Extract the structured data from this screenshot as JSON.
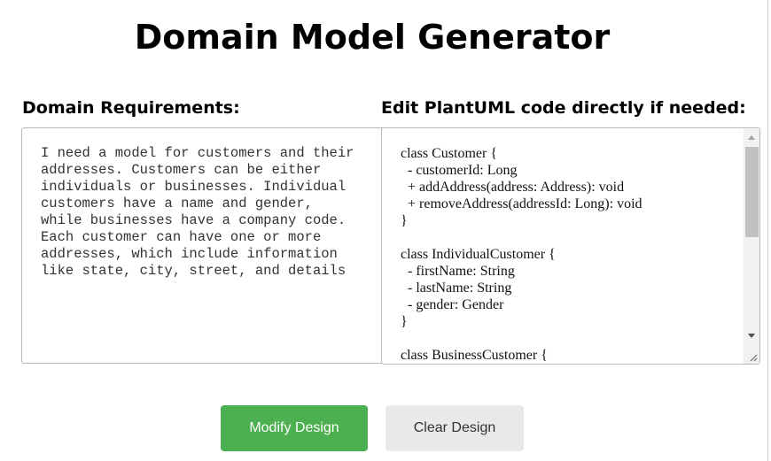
{
  "page": {
    "title": "Domain Model Generator"
  },
  "requirements": {
    "label": "Domain Requirements:",
    "value": "I need a model for customers and their\naddresses. Customers can be either\nindividuals or businesses. Individual\ncustomers have a name and gender,\nwhile businesses have a company code.\nEach customer can have one or more\naddresses, which include information\nlike state, city, street, and details"
  },
  "plantuml": {
    "label": "Edit PlantUML code directly if needed:",
    "code": "class Customer {\n  - customerId: Long\n  + addAddress(address: Address): void\n  + removeAddress(addressId: Long): void\n}\n\nclass IndividualCustomer {\n  - firstName: String\n  - lastName: String\n  - gender: Gender\n}\n\nclass BusinessCustomer {"
  },
  "buttons": {
    "modify_label": "Modify Design",
    "clear_label": "Clear Design"
  },
  "icons": {
    "scroll_up": "chevron-up-icon",
    "scroll_down": "chevron-down-icon",
    "resize": "resize-grip-icon"
  },
  "colors": {
    "modify_button_bg": "#4caf50",
    "clear_button_bg": "#e9e9e9",
    "modify_button_text": "#ffffff",
    "clear_button_text": "#333333"
  }
}
